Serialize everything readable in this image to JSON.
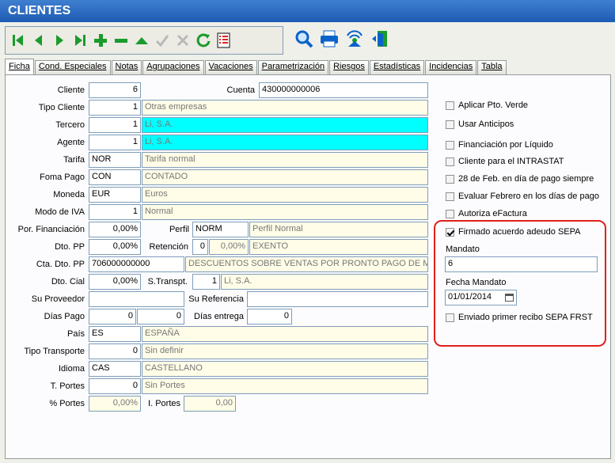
{
  "window": {
    "title": "CLIENTES"
  },
  "toolbar": {
    "nav_buttons": [
      {
        "icon": "first-record-icon"
      },
      {
        "icon": "previous-record-icon"
      },
      {
        "icon": "next-record-icon"
      },
      {
        "icon": "last-record-icon"
      },
      {
        "icon": "add-icon"
      },
      {
        "icon": "remove-icon"
      },
      {
        "icon": "up-icon"
      },
      {
        "icon": "confirm-icon"
      },
      {
        "icon": "cancel-icon"
      },
      {
        "icon": "refresh-icon"
      },
      {
        "icon": "list-icon"
      }
    ],
    "tool_buttons": [
      {
        "icon": "search-icon"
      },
      {
        "icon": "print-icon"
      },
      {
        "icon": "signal-icon"
      },
      {
        "icon": "exit-door-icon"
      }
    ]
  },
  "tabs": [
    {
      "label": "Ficha",
      "active": true
    },
    {
      "label": "Cond. Especiales"
    },
    {
      "label": "Notas"
    },
    {
      "label": "Agrupaciones"
    },
    {
      "label": "Vacaciones"
    },
    {
      "label": "Parametrización"
    },
    {
      "label": "Riesgos"
    },
    {
      "label": "Estadísticas"
    },
    {
      "label": "Incidencias"
    },
    {
      "label": "Tabla"
    }
  ],
  "form": {
    "cliente": {
      "label": "Cliente",
      "value": "6"
    },
    "cuenta": {
      "label": "Cuenta",
      "value": "430000000006"
    },
    "tipo_cliente": {
      "label": "Tipo Cliente",
      "code": "1",
      "desc": "Otras empresas"
    },
    "tercero": {
      "label": "Tercero",
      "code": "1",
      "desc": "Li, S.A."
    },
    "agente": {
      "label": "Agente",
      "code": "1",
      "desc": "Li, S.A."
    },
    "tarifa": {
      "label": "Tarifa",
      "code": "NOR",
      "desc": "Tarifa normal"
    },
    "foma_pago": {
      "label": "Foma Pago",
      "code": "CON",
      "desc": "CONTADO"
    },
    "moneda": {
      "label": "Moneda",
      "code": "EUR",
      "desc": "Euros"
    },
    "modo_iva": {
      "label": "Modo de IVA",
      "code": "1",
      "desc": "Normal"
    },
    "por_financiacion": {
      "label": "Por. Financiación",
      "value": "0,00%"
    },
    "perfil": {
      "label": "Perfil",
      "code": "NORM",
      "desc": "Perfil Normal"
    },
    "dto_pp": {
      "label": "Dto. PP",
      "value": "0,00%"
    },
    "retencion": {
      "label": "Retención",
      "code": "0",
      "pct": "0,00%",
      "desc": "EXENTO"
    },
    "cta_dto_pp": {
      "label": "Cta. Dto. PP",
      "code": "706000000000",
      "desc": "DESCUENTOS SOBRE VENTAS POR PRONTO PAGO DE MI"
    },
    "dto_cial": {
      "label": "Dto. Cial",
      "value": "0,00%"
    },
    "s_transpt": {
      "label": "S.Transpt.",
      "code": "1",
      "desc": "Li, S.A."
    },
    "su_proveedor": {
      "label": "Su Proveedor",
      "value": ""
    },
    "su_referencia": {
      "label": "Su Referencia",
      "value": ""
    },
    "dias_pago": {
      "label": "Días Pago",
      "value1": "0",
      "value2": "0"
    },
    "dias_entrega": {
      "label": "Días entrega",
      "value": "0"
    },
    "pais": {
      "label": "País",
      "code": "ES",
      "desc": "ESPAÑA"
    },
    "tipo_transporte": {
      "label": "Tipo Transporte",
      "code": "0",
      "desc": "Sin definir"
    },
    "idioma": {
      "label": "Idioma",
      "code": "CAS",
      "desc": "CASTELLANO"
    },
    "t_portes": {
      "label": "T. Portes",
      "code": "0",
      "desc": "Sin Portes"
    },
    "pct_portes": {
      "label": "% Portes",
      "value": "0,00%"
    },
    "i_portes": {
      "label": "I. Portes",
      "value": "0,00"
    }
  },
  "options": {
    "aplicar_pto_verde": {
      "label": "Aplicar Pto. Verde",
      "checked": false
    },
    "usar_anticipos": {
      "label": "Usar Anticipos",
      "checked": false
    },
    "financiacion_liquido": {
      "label": "Financiación por Líquido",
      "checked": false
    },
    "intrastat": {
      "label": "Cliente para el INTRASTAT",
      "checked": false
    },
    "feb28": {
      "label": "28 de Feb. en día de pago siempre",
      "checked": false
    },
    "evaluar_febrero": {
      "label": "Evaluar Febrero en los días de pago",
      "checked": false
    },
    "autoriza_efactura": {
      "label": "Autoriza eFactura",
      "checked": false
    }
  },
  "sepa": {
    "firmado": {
      "label": "Firmado acuerdo adeudo SEPA",
      "checked": true
    },
    "mandato_label": "Mandato",
    "mandato_value": "6",
    "fecha_label": "Fecha Mandato",
    "fecha_value": "01/01/2014",
    "enviado": {
      "label": "Enviado primer recibo SEPA FRST",
      "checked": false
    },
    "highlight_color": "#e0201c"
  },
  "colors": {
    "title_bar": "#1e5bb3",
    "readonly_field": "#fffde7",
    "highlight_field": "#00ffff",
    "toolbar_green": "#1a9b2c"
  }
}
